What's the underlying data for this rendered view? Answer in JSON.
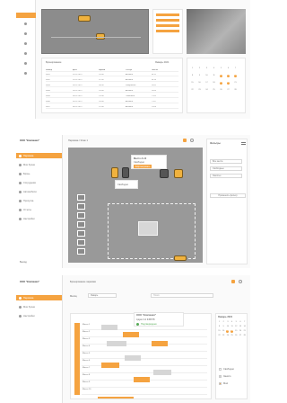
{
  "shot1": {
    "title": "Бронирование",
    "filter_label": "Январь 2021",
    "table_headers": [
      "Номер",
      "Дата",
      "Время",
      "Статус",
      "Место"
    ],
    "table_rows": [
      [
        "0001",
        "12.01.2021",
        "10:00",
        "Активно",
        "A-12"
      ],
      [
        "0002",
        "12.01.2021",
        "11:00",
        "Активно",
        "A-14"
      ],
      [
        "0003",
        "13.01.2021",
        "09:30",
        "Завершено",
        "B-02"
      ],
      [
        "0004",
        "13.01.2021",
        "14:00",
        "Активно",
        "B-05"
      ],
      [
        "0005",
        "14.01.2021",
        "15:30",
        "Отменено",
        "C-01"
      ],
      [
        "0006",
        "15.01.2021",
        "16:00",
        "Активно",
        "C-07"
      ],
      [
        "0007",
        "16.01.2021",
        "12:00",
        "Активно",
        "D-03"
      ]
    ],
    "calendar_days": [
      "1",
      "2",
      "3",
      "4",
      "5",
      "6",
      "7",
      "8",
      "9",
      "10",
      "11",
      "12",
      "13",
      "14",
      "15",
      "16",
      "17",
      "18",
      "19",
      "20",
      "21",
      "22",
      "23",
      "24",
      "25",
      "26",
      "27",
      "28"
    ]
  },
  "shot2": {
    "company": "ООО \"Компания\"",
    "breadcrumb": "Парковка / Этаж 1",
    "nav": [
      "Парковка",
      "Мои брони",
      "Бронь",
      "Сотрудники",
      "Автомобили",
      "Пропуска",
      "Отчеты",
      "Настройки"
    ],
    "popup_title": "Место A-12",
    "popup_text": "Свободно",
    "popup_button": "Забронировать",
    "panel_title": "Фильтры",
    "panel_items": [
      "Все места",
      "Свободные",
      "Занятые"
    ],
    "panel_button": "Применить фильтр",
    "logout": "Выход"
  },
  "shot3": {
    "company": "ООО \"Компания\"",
    "title": "Бронирование парковки",
    "nav": [
      "Парковка",
      "Мои брони",
      "Настройки"
    ],
    "select_label": "Месяц",
    "select_value": "Январь",
    "search_placeholder": "Поиск",
    "tooltip_title": "ООО \"Компания\"",
    "tooltip_line": "Адрес 12 345678",
    "tooltip_status": "Подтверждено",
    "calendar_title": "Январь 2021",
    "legend": [
      "Свободно",
      "Занято",
      "Моё"
    ],
    "row_labels": [
      "Место 1",
      "Место 2",
      "Место 3",
      "Место 4",
      "Место 5",
      "Место 6",
      "Место 7",
      "Место 8",
      "Место 9",
      "Место 10"
    ]
  }
}
